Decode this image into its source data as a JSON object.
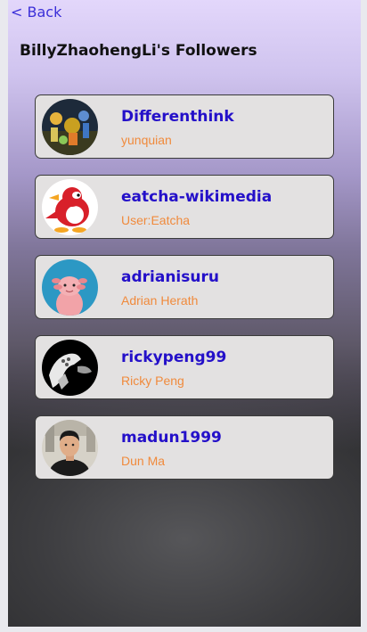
{
  "nav": {
    "back_label": "< Back"
  },
  "page": {
    "title": "BillyZhaohengLi's Followers"
  },
  "followers": [
    {
      "username": "Differenthink",
      "display_name": "yunquian",
      "avatar": "colorful-figurines-avatar"
    },
    {
      "username": "eatcha-wikimedia",
      "display_name": "User:Eatcha",
      "avatar": "red-penguin-avatar"
    },
    {
      "username": "adrianisuru",
      "display_name": "Adrian Herath",
      "avatar": "pink-axolotl-avatar"
    },
    {
      "username": "rickypeng99",
      "display_name": "Ricky Peng",
      "avatar": "black-white-illustration-avatar"
    },
    {
      "username": "madun1999",
      "display_name": "Dun Ma",
      "avatar": "person-photo-avatar"
    }
  ]
}
